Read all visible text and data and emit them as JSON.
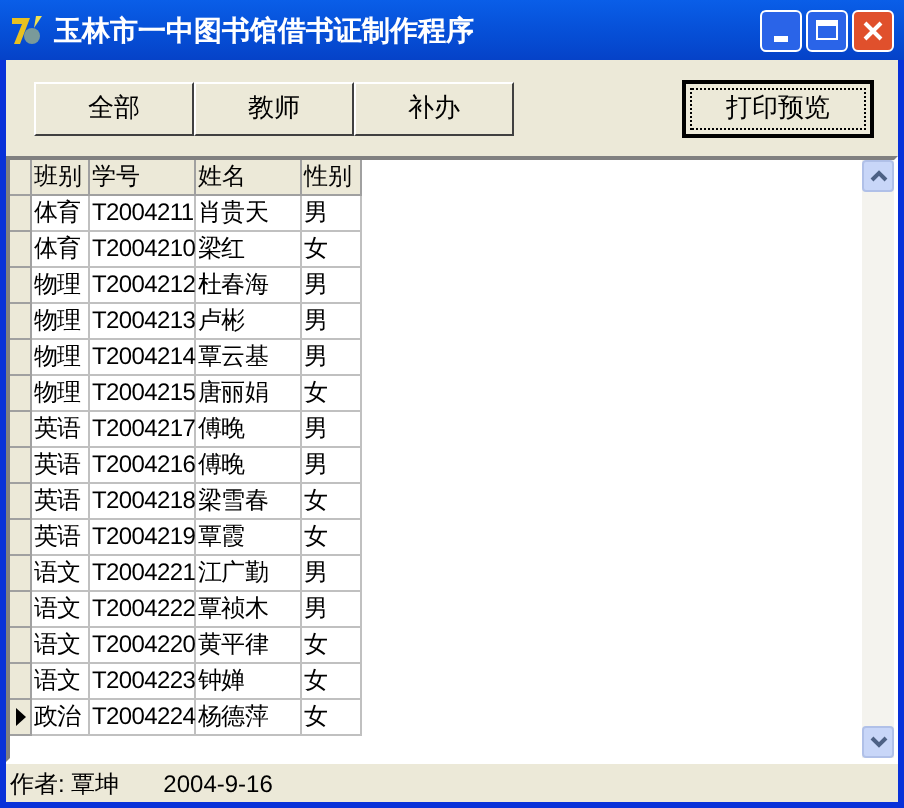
{
  "window": {
    "title": "玉林市一中图书馆借书证制作程序"
  },
  "filter_buttons": [
    "全部",
    "教师",
    "补办"
  ],
  "print_button": "打印预览",
  "table": {
    "columns": [
      "班别",
      "学号",
      "姓名",
      "性别"
    ],
    "rows": [
      {
        "cells": [
          "体育",
          "T2004211",
          "肖贵天",
          "男"
        ],
        "selected": false
      },
      {
        "cells": [
          "体育",
          "T2004210",
          "梁红",
          "女"
        ],
        "selected": false
      },
      {
        "cells": [
          "物理",
          "T2004212",
          "杜春海",
          "男"
        ],
        "selected": false
      },
      {
        "cells": [
          "物理",
          "T2004213",
          "卢彬",
          "男"
        ],
        "selected": false
      },
      {
        "cells": [
          "物理",
          "T2004214",
          "覃云基",
          "男"
        ],
        "selected": false
      },
      {
        "cells": [
          "物理",
          "T2004215",
          "唐丽娟",
          "女"
        ],
        "selected": false
      },
      {
        "cells": [
          "英语",
          "T2004217",
          "傅晚",
          "男"
        ],
        "selected": false
      },
      {
        "cells": [
          "英语",
          "T2004216",
          "傅晚",
          "男"
        ],
        "selected": false
      },
      {
        "cells": [
          "英语",
          "T2004218",
          "梁雪春",
          "女"
        ],
        "selected": false
      },
      {
        "cells": [
          "英语",
          "T2004219",
          "覃霞",
          "女"
        ],
        "selected": false
      },
      {
        "cells": [
          "语文",
          "T2004221",
          "江广勤",
          "男"
        ],
        "selected": false
      },
      {
        "cells": [
          "语文",
          "T2004222",
          "覃祯木",
          "男"
        ],
        "selected": false
      },
      {
        "cells": [
          "语文",
          "T2004220",
          "黄平律",
          "女"
        ],
        "selected": false
      },
      {
        "cells": [
          "语文",
          "T2004223",
          "钟婵",
          "女"
        ],
        "selected": false
      },
      {
        "cells": [
          "政治",
          "T2004224",
          "杨德萍",
          "女"
        ],
        "selected": true
      }
    ]
  },
  "status_bar": {
    "author": "作者: 覃坤",
    "date": "2004-9-16"
  }
}
